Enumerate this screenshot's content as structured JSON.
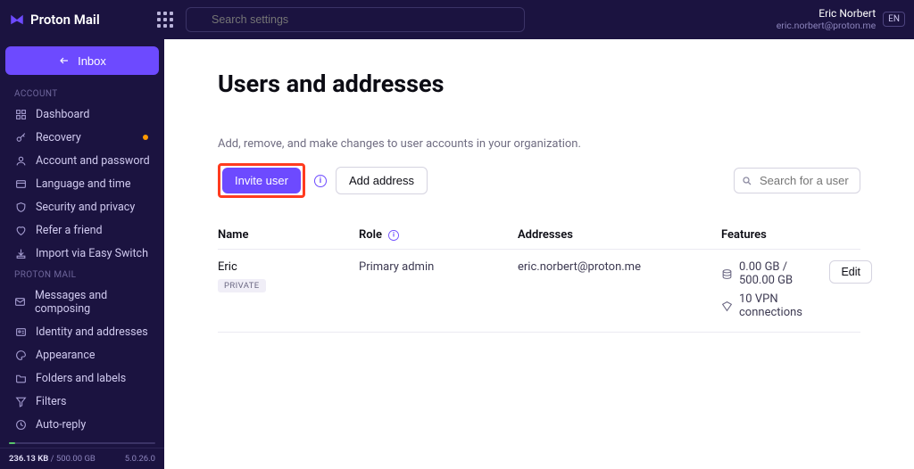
{
  "brand": {
    "name": "Proton Mail"
  },
  "topbar": {
    "search_placeholder": "Search settings",
    "user_name": "Eric Norbert",
    "user_email": "eric.norbert@proton.me",
    "lang": "EN"
  },
  "sidebar": {
    "inbox_label": "Inbox",
    "section_account": "ACCOUNT",
    "section_mail": "PROTON MAIL",
    "account_items": [
      {
        "label": "Dashboard",
        "badge": false
      },
      {
        "label": "Recovery",
        "badge": true
      },
      {
        "label": "Account and password",
        "badge": false
      },
      {
        "label": "Language and time",
        "badge": false
      },
      {
        "label": "Security and privacy",
        "badge": false
      },
      {
        "label": "Refer a friend",
        "badge": false
      },
      {
        "label": "Import via Easy Switch",
        "badge": false
      }
    ],
    "mail_items": [
      {
        "label": "Messages and composing"
      },
      {
        "label": "Identity and addresses"
      },
      {
        "label": "Appearance"
      },
      {
        "label": "Folders and labels"
      },
      {
        "label": "Filters"
      },
      {
        "label": "Auto-reply"
      }
    ],
    "storage_used": "236.13 KB",
    "storage_sep": " / ",
    "storage_total": "500.00 GB",
    "version": "5.0.26.0"
  },
  "page": {
    "title": "Users and addresses",
    "description": "Add, remove, and make changes to user accounts in your organization.",
    "invite_button": "Invite user",
    "add_address_button": "Add address",
    "search_placeholder": "Search for a user or address"
  },
  "table": {
    "headers": {
      "name": "Name",
      "role": "Role",
      "addresses": "Addresses",
      "features": "Features"
    },
    "rows": [
      {
        "name": "Eric",
        "badge": "PRIVATE",
        "role": "Primary admin",
        "address": "eric.norbert@proton.me",
        "storage": "0.00 GB / 500.00 GB",
        "vpn": "10 VPN connections",
        "edit": "Edit"
      }
    ]
  }
}
